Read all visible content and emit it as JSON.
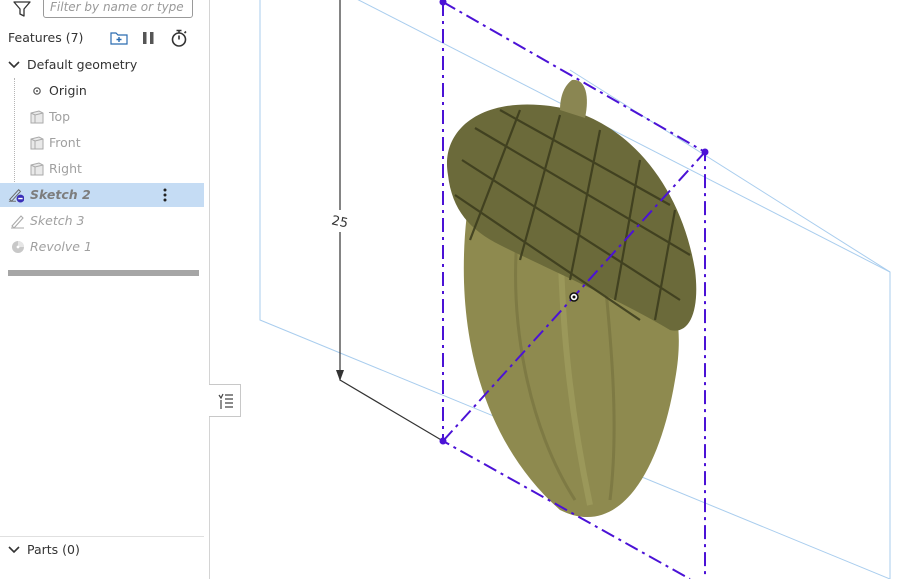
{
  "filter": {
    "placeholder": "Filter by name or type"
  },
  "features": {
    "title": "Features (7)",
    "header_icons": [
      "add-folder-icon",
      "pause-icon",
      "stopwatch-icon"
    ]
  },
  "tree": {
    "default_geometry": "Default geometry",
    "origin": "Origin",
    "planes": [
      "Top",
      "Front",
      "Right"
    ],
    "sketch2": "Sketch 2",
    "sketch3": "Sketch 3",
    "revolve1": "Revolve 1"
  },
  "parts": {
    "label": "Parts (0)"
  },
  "viewport": {
    "dimension_label": "25",
    "image_subject": "acorn",
    "colors": {
      "sketch": "#4b12d6",
      "plane": "#a9cdee",
      "dimension": "#333333"
    }
  }
}
